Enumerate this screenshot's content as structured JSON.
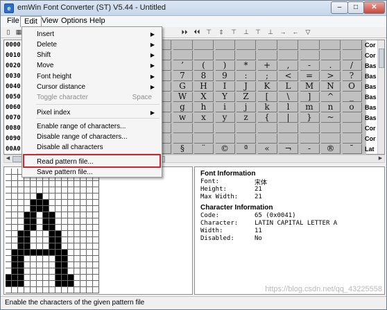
{
  "window": {
    "title": "emWin Font Converter (ST) V5.44 - Untitled",
    "icon_letter": "e",
    "minimize": "–",
    "maximize": "□",
    "close": "✕"
  },
  "menubar": [
    "File",
    "Edit",
    "View",
    "Options",
    "Help"
  ],
  "toolbar_icons": [
    "new-file-icon",
    "toolbar-button",
    "next-page-icon",
    "first-page-icon",
    "previous-icon",
    "toggle-down-icon",
    "align-top-icon",
    "align-bottom-icon",
    "align-up-icon",
    "align-down-icon",
    "move-right-icon",
    "move-left-icon",
    "filter-icon"
  ],
  "toolbar_glyphs": [
    "▯",
    "▦",
    "⏵⏵",
    "⏴⏴",
    "⊤",
    "‡",
    "⊤",
    "⊥",
    "⊤",
    "⊥",
    "→",
    "←",
    "▽"
  ],
  "edit_menu": {
    "items": [
      {
        "label": "Insert",
        "submenu": true
      },
      {
        "label": "Delete",
        "submenu": true
      },
      {
        "label": "Shift",
        "submenu": true
      },
      {
        "label": "Move",
        "submenu": true
      },
      {
        "label": "Font height",
        "submenu": true
      },
      {
        "label": "Cursor distance",
        "submenu": true
      },
      {
        "label": "Toggle character",
        "shortcut": "Space",
        "disabled": true
      },
      {
        "label": "Pixel index",
        "submenu": true
      },
      {
        "label": "Enable range of characters..."
      },
      {
        "label": "Disable range of characters..."
      },
      {
        "label": "Disable all characters"
      },
      {
        "label": "Read pattern file..."
      },
      {
        "label": "Save pattern file..."
      }
    ],
    "submenu_arrow": "▶"
  },
  "codes": [
    "0000",
    "0010",
    "0020",
    "0030",
    "0040",
    "0050",
    "0060",
    "0070",
    "0080",
    "0090",
    "00A0"
  ],
  "grid_rows": [
    [
      "",
      "",
      "",
      "",
      "",
      "",
      "",
      "",
      "",
      "",
      "",
      "",
      "",
      "",
      "",
      ""
    ],
    [
      "",
      "",
      "",
      "",
      "",
      "",
      "",
      "",
      "",
      "",
      "",
      "",
      "",
      "",
      "",
      ""
    ],
    [
      "",
      "",
      "",
      "",
      "",
      "",
      "",
      "’",
      "(",
      ")",
      "*",
      "+",
      ",",
      "-",
      ".",
      "/"
    ],
    [
      "",
      "",
      "",
      "",
      "",
      "",
      "",
      "7",
      "8",
      "9",
      ":",
      ";",
      "<",
      "=",
      ">",
      "?"
    ],
    [
      "",
      "",
      "",
      "",
      "",
      "",
      "",
      "G",
      "H",
      "I",
      "J",
      "K",
      "L",
      "M",
      "N",
      "O"
    ],
    [
      "",
      "",
      "",
      "",
      "",
      "",
      "",
      "W",
      "X",
      "Y",
      "Z",
      "[",
      "\\",
      "]",
      "^",
      "_"
    ],
    [
      "",
      "",
      "",
      "",
      "",
      "",
      "",
      "g",
      "h",
      "i",
      "j",
      "k",
      "l",
      "m",
      "n",
      "o"
    ],
    [
      "",
      "",
      "",
      "",
      "",
      "",
      "",
      "w",
      "x",
      "y",
      "z",
      "{",
      "|",
      "}",
      "~",
      ""
    ],
    [
      "",
      "",
      "",
      "",
      "",
      "",
      "",
      "",
      "",
      "",
      "",
      "",
      "",
      "",
      "",
      ""
    ],
    [
      "",
      "",
      "",
      "",
      "",
      "",
      "",
      "",
      "",
      "",
      "",
      "",
      "",
      "",
      "",
      ""
    ],
    [
      "",
      "",
      "",
      "",
      "",
      "",
      "",
      "§",
      "¨",
      "©",
      "ª",
      "«",
      "¬",
      "-",
      "®",
      "¯"
    ]
  ],
  "categories": [
    "Cor",
    "Cor",
    "Bas",
    "Bas",
    "Bas",
    "Bas",
    "Bas",
    "Bas",
    "Cor",
    "Cor",
    "Lat"
  ],
  "font_info": {
    "heading": "Font Information",
    "font_label": "Font:",
    "font_value": "宋体",
    "height_label": "Height:",
    "height_value": "21",
    "maxwidth_label": "Max Width:",
    "maxwidth_value": "21"
  },
  "char_info": {
    "heading": "Character Information",
    "code_label": "Code:",
    "code_value": "65 (0x0041)",
    "char_label": "Character:",
    "char_value": "LATIN CAPITAL LETTER A",
    "width_label": "Width:",
    "width_value": "11",
    "disabled_label": "Disabled:",
    "disabled_value": "No"
  },
  "pixel_bitmap": [
    "...............",
    "...............",
    "...............",
    "...............",
    ".....#.........",
    "....###........",
    "....###........",
    "...##.##.......",
    "...##.##.......",
    "...##.##.......",
    "..##...##......",
    "..##...##......",
    "..##...##......",
    ".#########.....",
    ".##.....##.....",
    ".##.....##.....",
    ".##.....##.....",
    "###.....###....",
    "###.....###....",
    "..............."
  ],
  "status": "Enable the characters of the given pattern file",
  "watermark": "https://blog.csdn.net/qq_43225558"
}
